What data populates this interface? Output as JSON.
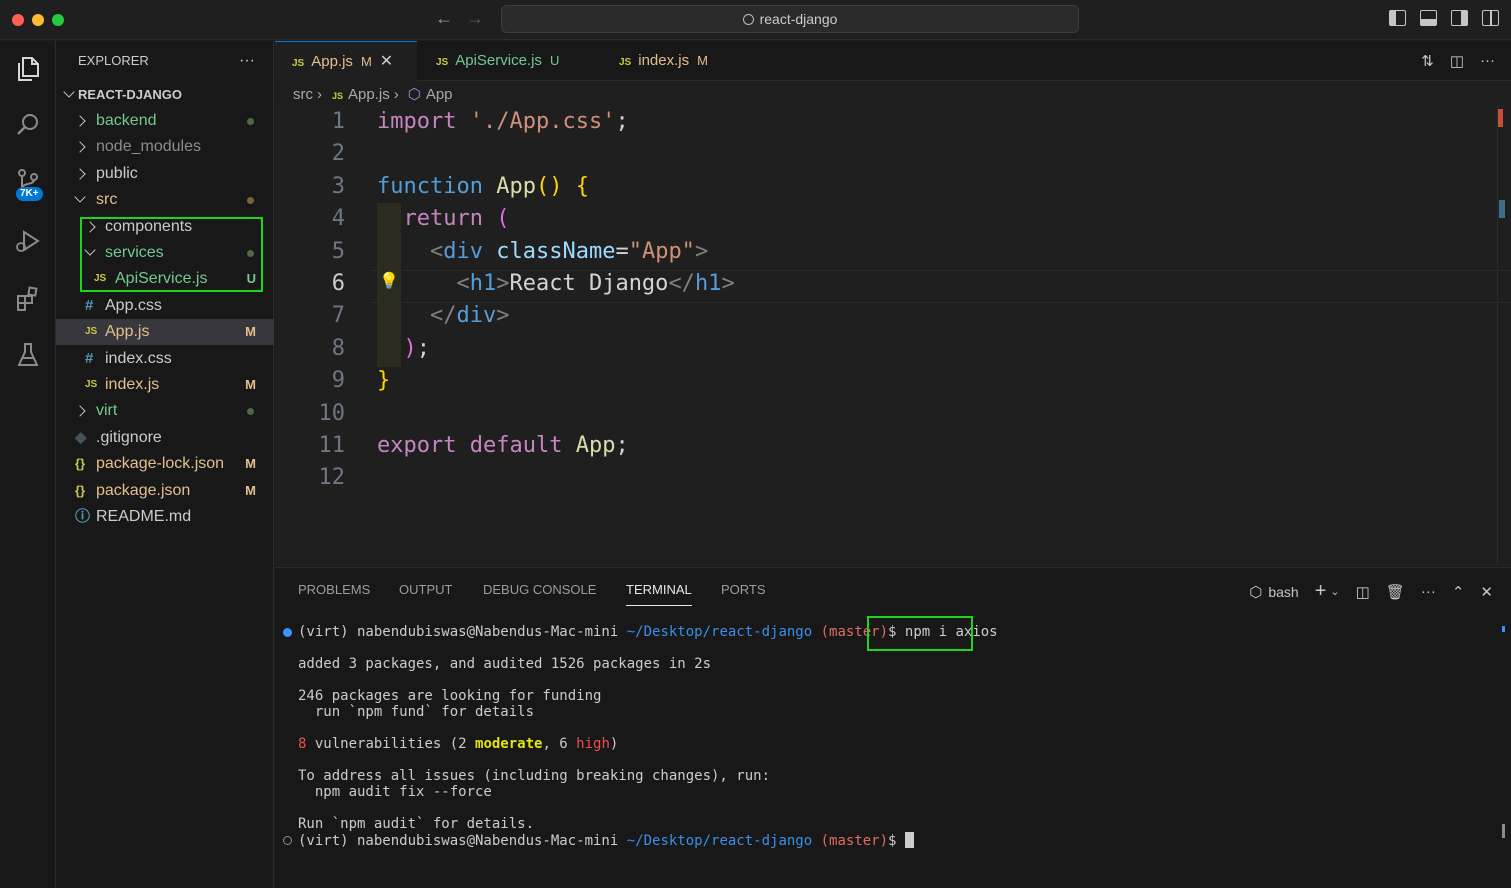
{
  "titlebar": {
    "search_text": "react-django"
  },
  "activity": {
    "scm_badge": "7K+"
  },
  "explorer": {
    "title": "EXPLORER",
    "more": "···",
    "root": "REACT-DJANGO",
    "items": [
      {
        "label": "backend",
        "status": "dot"
      },
      {
        "label": "node_modules",
        "status": ""
      },
      {
        "label": "public",
        "status": ""
      },
      {
        "label": "src",
        "status": "dot"
      },
      {
        "label": "components",
        "status": ""
      },
      {
        "label": "services",
        "status": "dot"
      },
      {
        "label": "ApiService.js",
        "status": "U"
      },
      {
        "label": "App.css",
        "status": ""
      },
      {
        "label": "App.js",
        "status": "M"
      },
      {
        "label": "index.css",
        "status": ""
      },
      {
        "label": "index.js",
        "status": "M"
      },
      {
        "label": "virt",
        "status": "dot"
      },
      {
        "label": ".gitignore",
        "status": ""
      },
      {
        "label": "package-lock.json",
        "status": "M"
      },
      {
        "label": "package.json",
        "status": "M"
      },
      {
        "label": "README.md",
        "status": ""
      }
    ]
  },
  "tabs": [
    {
      "label": "App.js",
      "status": "M",
      "icon": "JS"
    },
    {
      "label": "ApiService.js",
      "status": "U",
      "icon": "JS"
    },
    {
      "label": "index.js",
      "status": "M",
      "icon": "JS"
    }
  ],
  "breadcrumb": {
    "folder": "src",
    "file": "App.js",
    "symbol": "App",
    "js_label": "JS"
  },
  "editor": {
    "line_numbers": [
      "1",
      "2",
      "3",
      "4",
      "5",
      "6",
      "7",
      "8",
      "9",
      "10",
      "11",
      "12"
    ],
    "code": {
      "l1_kw": "import",
      "l1_str": "'./App.css'",
      "l1_end": ";",
      "l3_kw": "function",
      "l3_fn": "App",
      "l3_paren": "()",
      "l3_brace": "{",
      "l4_kw": "return",
      "l4_paren": "(",
      "l5_open": "<",
      "l5_tag": "div",
      "l5_attr": "className",
      "l5_eq": "=",
      "l5_val": "\"App\"",
      "l5_close": ">",
      "l6_open": "<",
      "l6_tag": "h1",
      "l6_gt": ">",
      "l6_text": "React Django",
      "l6_close_open": "</",
      "l6_close_tag": "h1",
      "l6_close_gt": ">",
      "l7_open": "</",
      "l7_tag": "div",
      "l7_gt": ">",
      "l8_paren": ")",
      "l8_semi": ";",
      "l9_brace": "}",
      "l11_kw1": "export",
      "l11_kw2": "default",
      "l11_name": "App",
      "l11_semi": ";"
    }
  },
  "panel": {
    "tabs": [
      "PROBLEMS",
      "OUTPUT",
      "DEBUG CONSOLE",
      "TERMINAL",
      "PORTS"
    ],
    "active_tab": "TERMINAL",
    "shell": "bash"
  },
  "terminal": {
    "prompt_env": "(virt) nabendubiswas@Nabendus-Mac-mini ",
    "prompt_path": "~/Desktop/react-django",
    "prompt_branch": " (master)",
    "prompt_symbol": "$ ",
    "command": "npm i axios",
    "out1": "added 3 packages, and audited 1526 packages in 2s",
    "out2": "246 packages are looking for funding",
    "out3": "  run `npm fund` for details",
    "vuln_count": "8",
    "vuln_text1": " vulnerabilities (2 ",
    "vuln_moderate": "moderate",
    "vuln_text2": ", 6 ",
    "vuln_high": "high",
    "vuln_text3": ")",
    "out5": "To address all issues (including breaking changes), run:",
    "out6": "  npm audit fix --force",
    "out7": "Run `npm audit` for details.",
    "prompt2_env": "(virt) nabendubiswas@Nabendus-Mac-mini ",
    "prompt2_path": "~/Desktop/react-django",
    "prompt2_branch": " (master)",
    "prompt2_symbol": "$ "
  },
  "colors": {
    "accent": "#0078d4",
    "highlight_box": "#1ed41e",
    "git_modified": "#e2c08d",
    "git_untracked": "#73c991"
  }
}
